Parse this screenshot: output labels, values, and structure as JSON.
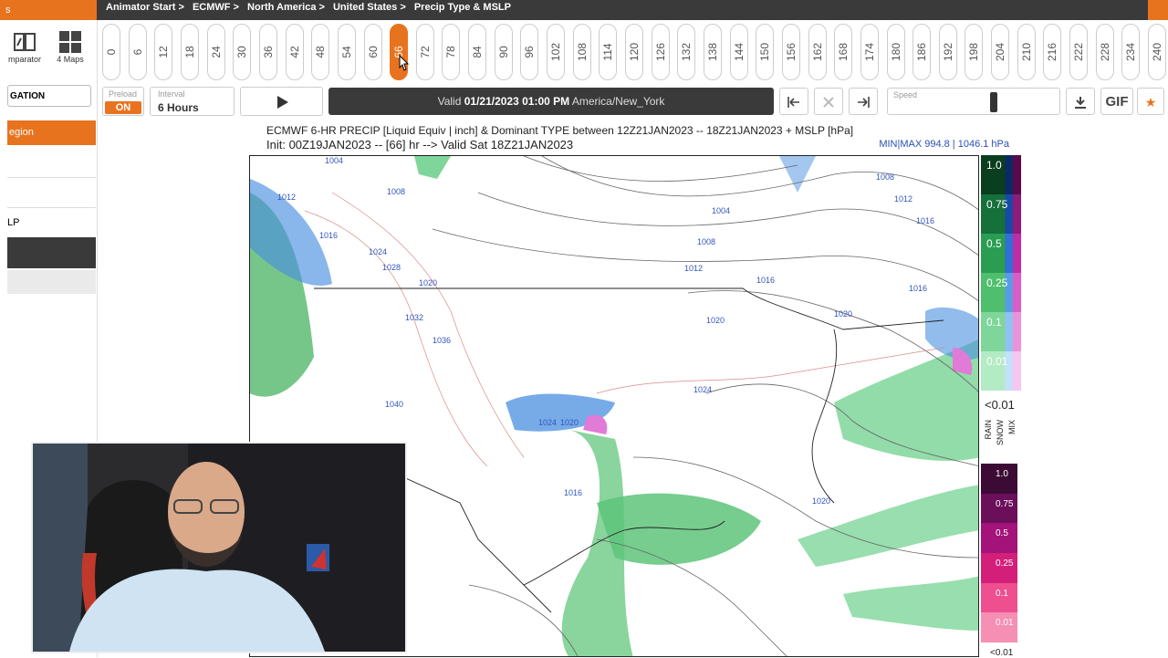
{
  "topbar": {
    "corner_text": "s",
    "breadcrumbs": [
      "Animator Start >",
      "ECMWF >",
      "North America >",
      "United States >",
      "Precip Type & MSLP"
    ]
  },
  "sidebar": {
    "comparator_label": "mparator",
    "four_maps_label": "4 Maps",
    "navigation_label": "GATION",
    "region_label": "egion",
    "mslp_label": "LP"
  },
  "timeline": {
    "hours": [
      "0",
      "6",
      "12",
      "18",
      "24",
      "30",
      "36",
      "42",
      "48",
      "54",
      "60",
      "66",
      "72",
      "78",
      "84",
      "90",
      "96",
      "102",
      "108",
      "114",
      "120",
      "126",
      "132",
      "138",
      "144",
      "150",
      "156",
      "162",
      "168",
      "174",
      "180",
      "186",
      "192",
      "198",
      "204",
      "210",
      "216",
      "222",
      "228",
      "234",
      "240"
    ],
    "active_hour": "66"
  },
  "controls": {
    "preload_label": "Preload",
    "preload_value": "ON",
    "interval_label": "Interval",
    "interval_value": "6 Hours",
    "play_icon": "play-icon",
    "valid_prefix": "Valid",
    "valid_datetime": "01/21/2023 01:00 PM",
    "valid_timezone": "America/New_York",
    "speed_label": "Speed",
    "gif_label": "GIF"
  },
  "chart": {
    "title": "ECMWF 6-HR PRECIP [Liquid Equiv | inch] & Dominant TYPE between 12Z21JAN2023 -- 18Z21JAN2023 + MSLP [hPa]",
    "init_line": "Init: 00Z19JAN2023 -- [66] hr --> Valid Sat 18Z21JAN2023",
    "minmax": "MIN|MAX 994.8 | 1046.1 hPa"
  },
  "legend": {
    "upper_labels": [
      "1.0",
      "0.75",
      "0.5",
      "0.25",
      "0.1",
      "0.01"
    ],
    "lt_label": "<0.01",
    "types": [
      "RAIN",
      "SNOW",
      "MIX"
    ],
    "lower_labels": [
      "1.0",
      "0.75",
      "0.5",
      "0.25",
      "0.1",
      "0.01"
    ],
    "lt_label_2": "<0.01",
    "colors": {
      "rain": [
        "#0b3d1f",
        "#15703a",
        "#2a9d52",
        "#4fbf6e",
        "#7fd69a",
        "#b3ebc4"
      ],
      "snow": [
        "#0a2a66",
        "#1749a8",
        "#2f6fd6",
        "#5a9be8",
        "#8fc1f2",
        "#c4e0fb"
      ],
      "mix": [
        "#5a0a4a",
        "#8e1a7a",
        "#c02ca8",
        "#db5cc6",
        "#ec92dc",
        "#f7c6ee"
      ],
      "lower": [
        "#3b0a35",
        "#6b0f5a",
        "#a3137a",
        "#d41f7a",
        "#ee4f8f",
        "#f58fb3"
      ]
    }
  },
  "map": {
    "pressure_labels": [
      "1004",
      "1008",
      "1012",
      "1016",
      "1020",
      "1024",
      "1028",
      "1032",
      "1036",
      "1040"
    ]
  }
}
